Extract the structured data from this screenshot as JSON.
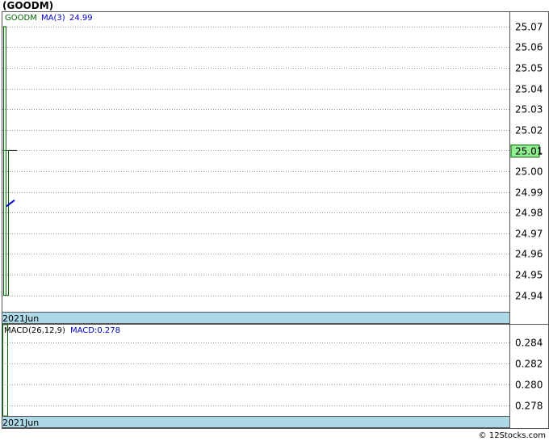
{
  "title": "(GOODM)",
  "footer": "© 12Stocks.com",
  "chart_data": [
    {
      "type": "bar",
      "panel": "price",
      "date_label": "2021Jun",
      "legend": {
        "symbol": "GOODM",
        "ma_label": "MA(3)",
        "ma_value": "24.99"
      },
      "ylim": [
        24.932,
        25.077
      ],
      "yticks": [
        24.94,
        24.95,
        24.96,
        24.97,
        24.98,
        24.99,
        25.0,
        25.01,
        25.02,
        25.03,
        25.04,
        25.05,
        25.06,
        25.07
      ],
      "ytick_labels": [
        "24.94",
        "24.95",
        "24.96",
        "24.97",
        "24.98",
        "24.99",
        "25.00",
        "25.01",
        "25.02",
        "25.03",
        "25.04",
        "25.05",
        "25.06",
        "25.07"
      ],
      "current_price": 25.01,
      "current_label": "25.01",
      "bars": [
        {
          "bottom": 24.94,
          "top": 25.07
        },
        {
          "bottom": 24.94,
          "top": 25.01
        }
      ],
      "close_tick": 25.01,
      "ma_segment": [
        24.983,
        24.986
      ],
      "colors": {
        "up": "#006400",
        "ma": "#0000cc",
        "current_bg": "#90ee90",
        "datebar_bg": "#add8e6"
      },
      "grid": true
    },
    {
      "type": "bar",
      "panel": "macd",
      "date_label": "2021Jun",
      "legend": {
        "macd_params": "MACD(26,12,9)",
        "macd_label": "MACD:0.278"
      },
      "ylim": [
        0.277,
        0.2857
      ],
      "yticks": [
        0.278,
        0.28,
        0.282,
        0.284
      ],
      "ytick_labels": [
        "0.278",
        "0.280",
        "0.282",
        "0.284"
      ],
      "bars": [
        {
          "bottom": 0.277,
          "top": 0.2857
        }
      ],
      "grid": true
    }
  ]
}
